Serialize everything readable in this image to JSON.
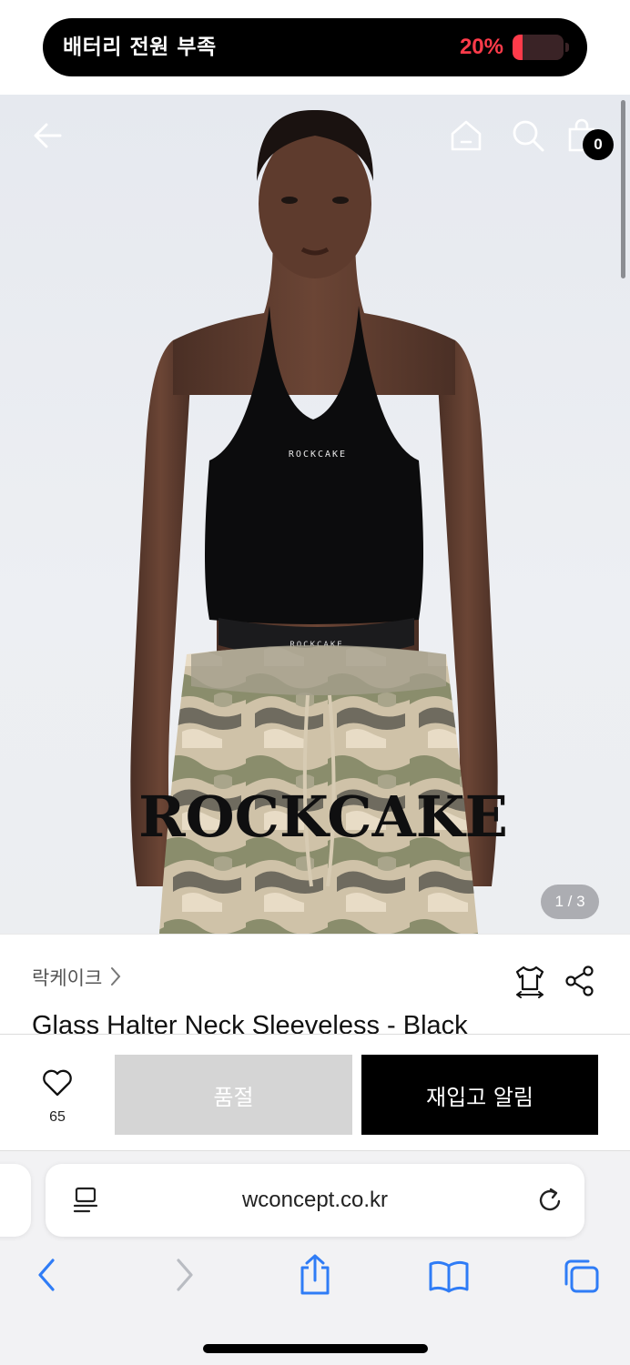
{
  "status_banner": {
    "message": "배터리 전원 부족",
    "battery_percent_label": "20%",
    "battery_level": 0.2,
    "alert_color": "#ff3b4a"
  },
  "header": {
    "back_icon": "arrow-left-icon",
    "home_icon": "home-icon",
    "search_icon": "search-icon",
    "cart_icon": "shopping-bag-icon",
    "cart_count": "0"
  },
  "gallery": {
    "pager": "1 / 3",
    "image_texts": {
      "top_logo": "ROCKCAKE",
      "waistband": "ROCKCAKE",
      "pants_print": "ROCKCAKE"
    }
  },
  "product": {
    "brand": "락케이크",
    "title": "Glass Halter Neck Sleeveless - Black",
    "size_icon": "size-guide-icon",
    "share_icon": "share-icon"
  },
  "purchase_bar": {
    "like_icon": "heart-icon",
    "like_count": "65",
    "sold_out_label": "품절",
    "restock_label": "재입고 알림",
    "sold_out_bg": "#d5d5d5",
    "restock_bg": "#000000"
  },
  "browser": {
    "url": "wconcept.co.kr",
    "reader_icon": "reader-mode-icon",
    "reload_icon": "reload-icon",
    "toolbar": [
      "back-icon",
      "forward-icon",
      "share-icon",
      "bookmarks-icon",
      "tabs-icon"
    ],
    "accent_color": "#2f7cf6"
  }
}
